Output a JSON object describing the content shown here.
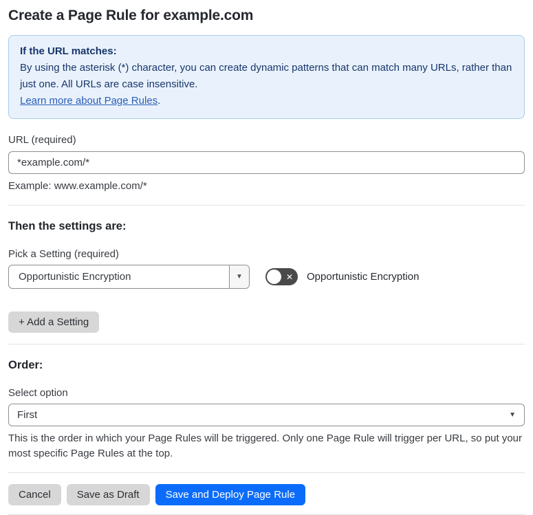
{
  "page": {
    "title": "Create a Page Rule for example.com"
  },
  "info_box": {
    "heading": "If the URL matches:",
    "body": "By using the asterisk (*) character, you can create dynamic patterns that can match many URLs, rather than just one. All URLs are case insensitive.",
    "link_label": "Learn more about Page Rules",
    "link_suffix": "."
  },
  "url_field": {
    "label": "URL (required)",
    "value": "*example.com/*",
    "helper": "Example: www.example.com/*"
  },
  "settings_section": {
    "heading": "Then the settings are:",
    "picker_label": "Pick a Setting (required)",
    "picker_value": "Opportunistic Encryption",
    "picker_caret_glyph": "▼",
    "toggle_state": "off",
    "toggle_off_glyph": "✕",
    "toggle_label": "Opportunistic Encryption",
    "add_setting_label": "+ Add a Setting"
  },
  "order_section": {
    "heading": "Order:",
    "select_label": "Select option",
    "select_value": "First",
    "select_caret_glyph": "▼",
    "helper": "This is the order in which your Page Rules will be triggered. Only one Page Rule will trigger per URL, so put your most specific Page Rules at the top."
  },
  "actions": {
    "cancel_label": "Cancel",
    "save_draft_label": "Save as Draft",
    "deploy_label": "Save and Deploy Page Rule"
  },
  "colors": {
    "accent_blue": "#0b6cfb",
    "info_bg": "#e9f2fc",
    "info_border": "#aacaec",
    "info_text": "#17356b",
    "link_blue": "#2b5db8",
    "button_gray": "#d7d7d7",
    "toggle_off_bg": "#4a4a4a",
    "input_border": "#8e8e8e",
    "divider": "#e2e2e2"
  }
}
